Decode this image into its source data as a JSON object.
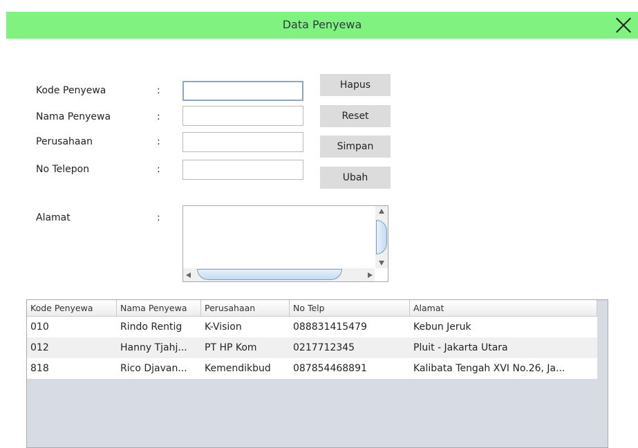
{
  "window": {
    "title": "Data Penyewa",
    "close_icon": "close-icon"
  },
  "form": {
    "fields": [
      {
        "label": "Kode Penyewa",
        "colon": ":",
        "value": ""
      },
      {
        "label": "Nama Penyewa",
        "colon": ":",
        "value": ""
      },
      {
        "label": "Perusahaan",
        "colon": ":",
        "value": ""
      },
      {
        "label": "No Telepon",
        "colon": ":",
        "value": ""
      }
    ],
    "alamat": {
      "label": "Alamat",
      "colon": ":",
      "value": ""
    }
  },
  "buttons": {
    "hapus": "Hapus",
    "reset": "Reset",
    "simpan": "Simpan",
    "ubah": "Ubah"
  },
  "table": {
    "columns": [
      "Kode Penyewa",
      "Nama Penyewa",
      "Perusahaan",
      "No Telp",
      "Alamat"
    ],
    "rows": [
      [
        "010",
        "Rindo Rentig",
        "K-Vision",
        "088831415479",
        "Kebun Jeruk"
      ],
      [
        "012",
        "Hanny Tjahj...",
        "PT HP Kom",
        "0217712345",
        "Pluit - Jakarta Utara"
      ],
      [
        "818",
        "Rico Djavan...",
        "Kemendikbud",
        "087854468891",
        "Kalibata Tengah XVI No.26, Ja..."
      ]
    ]
  },
  "colors": {
    "titlebar": "#7ff27f",
    "button": "#dcdcdc",
    "table_bg": "#d7dbe3"
  }
}
